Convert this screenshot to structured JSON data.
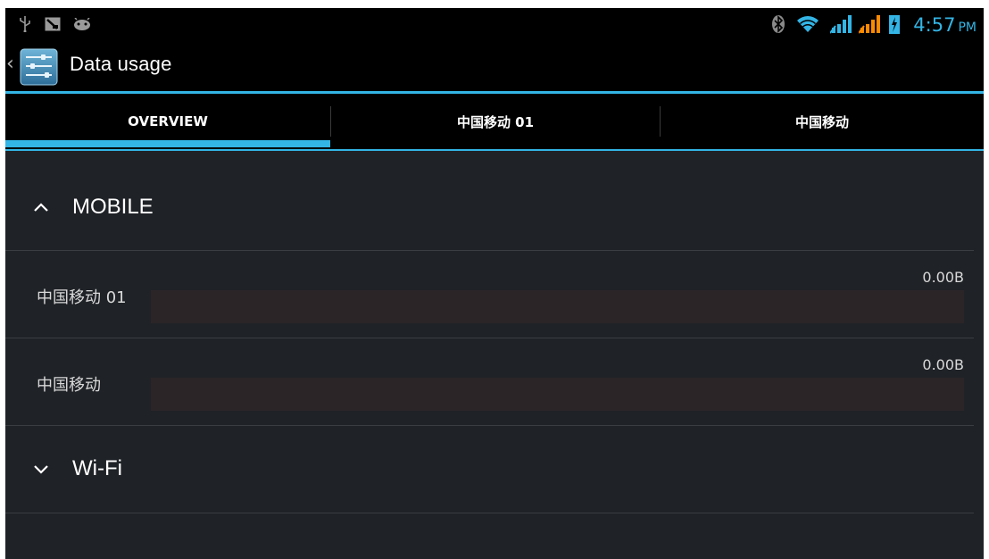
{
  "status_bar": {
    "left_icons": [
      "usb-icon",
      "screenshot-icon",
      "android-debug-icon"
    ],
    "right_icons": [
      "bluetooth-icon",
      "wifi-icon",
      "signal-1-icon",
      "signal-2-icon",
      "battery-charging-icon"
    ],
    "time": "4:57",
    "ampm": "PM"
  },
  "action_bar": {
    "back_icon": "back-caret-icon",
    "app_icon": "settings-sliders-icon",
    "title": "Data usage"
  },
  "tabs": [
    {
      "label": "OVERVIEW",
      "selected": true
    },
    {
      "label": "中国移动 01",
      "selected": false
    },
    {
      "label": "中国移动",
      "selected": false
    }
  ],
  "sections": {
    "mobile": {
      "label": "MOBILE",
      "expanded": true,
      "rows": [
        {
          "name": "中国移动 01",
          "value": "0.00B",
          "usage_fraction": 0
        },
        {
          "name": "中国移动",
          "value": "0.00B",
          "usage_fraction": 0
        }
      ]
    },
    "wifi": {
      "label": "Wi-Fi",
      "expanded": false
    }
  },
  "colors": {
    "accent": "#33b5e5",
    "background": "#1f2226",
    "bar_track": "#2b2528"
  }
}
